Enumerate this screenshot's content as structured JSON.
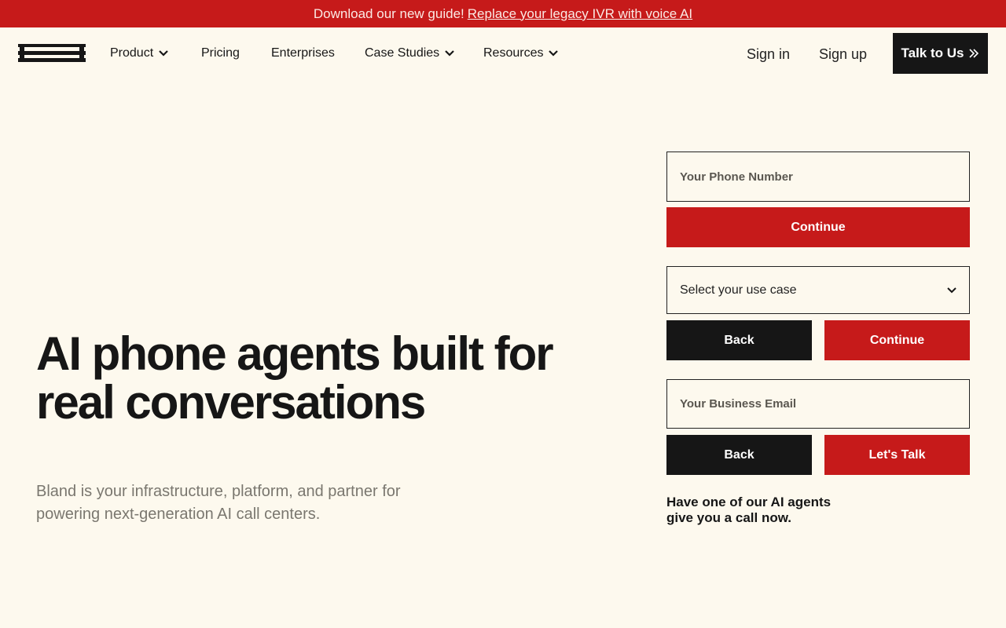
{
  "banner": {
    "text": "Download our new guide!",
    "link": "Replace your legacy IVR with voice AI"
  },
  "nav": {
    "logo_alt": "bland",
    "items": [
      {
        "label": "Product",
        "dropdown": true
      },
      {
        "label": "Pricing",
        "dropdown": false
      },
      {
        "label": "Enterprises",
        "dropdown": false
      },
      {
        "label": "Case Studies",
        "dropdown": true
      },
      {
        "label": "Resources",
        "dropdown": true
      }
    ],
    "sign_in": "Sign in",
    "sign_up": "Sign up",
    "cta": "Talk to Us"
  },
  "hero": {
    "title_line1": "AI phone agents built for",
    "title_line2": "real conversations",
    "subtitle": "Bland is your infrastructure, platform, and partner for powering next-generation AI call centers."
  },
  "form": {
    "phone_placeholder": "Your Phone Number",
    "continue_label": "Continue",
    "use_case_label": "Select your use case",
    "back_label": "Back",
    "email_placeholder": "Your Business Email",
    "lets_talk_label": "Let's Talk",
    "note": "Have one of our AI agents give you a call now."
  },
  "colors": {
    "accent": "#c61a1a",
    "dark": "#161616",
    "background": "#fdf9ee"
  }
}
